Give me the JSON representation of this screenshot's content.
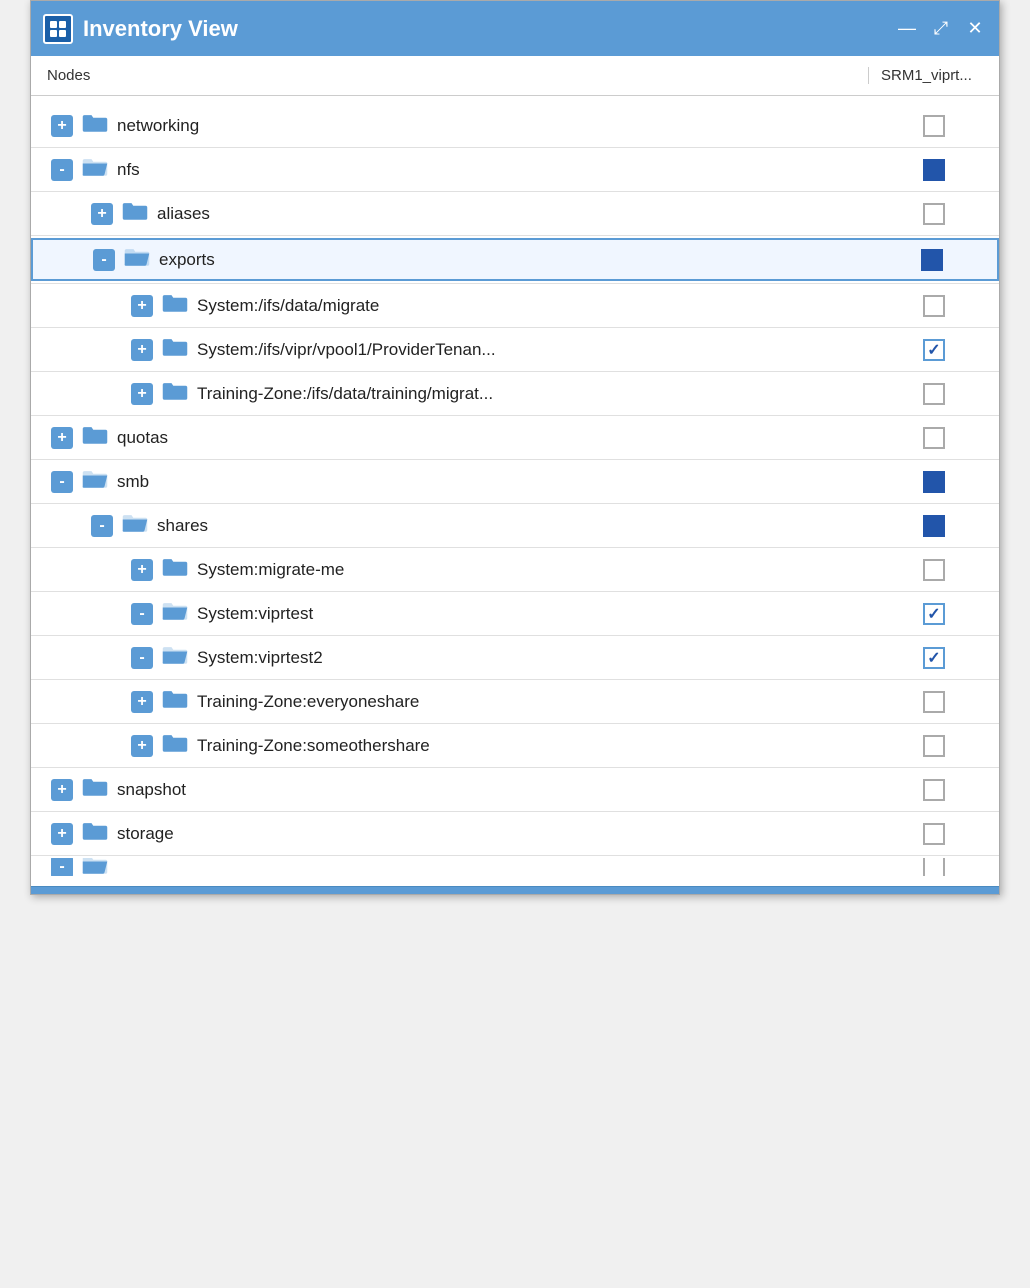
{
  "window": {
    "title": "Inventory View",
    "icon_label": "inventory-icon"
  },
  "header": {
    "nodes_label": "Nodes",
    "srm_label": "SRM1_viprt..."
  },
  "controls": {
    "minimize": "—",
    "maximize": "⤢",
    "close": "✕"
  },
  "tree": [
    {
      "id": "networking",
      "label": "networking",
      "level": 1,
      "toggle": "+",
      "folder_open": false,
      "checkbox": "empty",
      "selected": false
    },
    {
      "id": "nfs",
      "label": "nfs",
      "level": 1,
      "toggle": "-",
      "folder_open": true,
      "checkbox": "solid",
      "selected": false
    },
    {
      "id": "aliases",
      "label": "aliases",
      "level": 2,
      "toggle": "+",
      "folder_open": false,
      "checkbox": "empty",
      "selected": false
    },
    {
      "id": "exports",
      "label": "exports",
      "level": 2,
      "toggle": "-",
      "folder_open": true,
      "checkbox": "solid",
      "selected": true
    },
    {
      "id": "migrate",
      "label": "System:/ifs/data/migrate",
      "level": 3,
      "toggle": "+",
      "folder_open": false,
      "checkbox": "empty",
      "selected": false
    },
    {
      "id": "vipr",
      "label": "System:/ifs/vipr/vpool1/ProviderTenan...",
      "level": 3,
      "toggle": "+",
      "folder_open": false,
      "checkbox": "check",
      "selected": false
    },
    {
      "id": "training_migrate",
      "label": "Training-Zone:/ifs/data/training/migrat...",
      "level": 3,
      "toggle": "+",
      "folder_open": false,
      "checkbox": "empty",
      "selected": false
    },
    {
      "id": "quotas",
      "label": "quotas",
      "level": 1,
      "toggle": "+",
      "folder_open": false,
      "checkbox": "empty",
      "selected": false
    },
    {
      "id": "smb",
      "label": "smb",
      "level": 1,
      "toggle": "-",
      "folder_open": true,
      "checkbox": "solid",
      "selected": false
    },
    {
      "id": "shares",
      "label": "shares",
      "level": 2,
      "toggle": "-",
      "folder_open": true,
      "checkbox": "solid",
      "selected": false
    },
    {
      "id": "migrate_me",
      "label": "System:migrate-me",
      "level": 3,
      "toggle": "+",
      "folder_open": false,
      "checkbox": "empty",
      "selected": false
    },
    {
      "id": "viprtest",
      "label": "System:viprtest",
      "level": 3,
      "toggle": "-",
      "folder_open": true,
      "checkbox": "check",
      "selected": false
    },
    {
      "id": "viprtest2",
      "label": "System:viprtest2",
      "level": 3,
      "toggle": "-",
      "folder_open": true,
      "checkbox": "check",
      "selected": false
    },
    {
      "id": "everyoneshare",
      "label": "Training-Zone:everyoneshare",
      "level": 3,
      "toggle": "+",
      "folder_open": false,
      "checkbox": "empty",
      "selected": false
    },
    {
      "id": "someothershare",
      "label": "Training-Zone:someothershare",
      "level": 3,
      "toggle": "+",
      "folder_open": false,
      "checkbox": "empty",
      "selected": false
    },
    {
      "id": "snapshot",
      "label": "snapshot",
      "level": 1,
      "toggle": "+",
      "folder_open": false,
      "checkbox": "empty",
      "selected": false
    },
    {
      "id": "storage",
      "label": "storage",
      "level": 1,
      "toggle": "+",
      "folder_open": false,
      "checkbox": "empty",
      "selected": false
    },
    {
      "id": "more",
      "label": "",
      "level": 1,
      "toggle": "-",
      "folder_open": true,
      "checkbox": "empty",
      "selected": false,
      "hidden": true
    }
  ]
}
